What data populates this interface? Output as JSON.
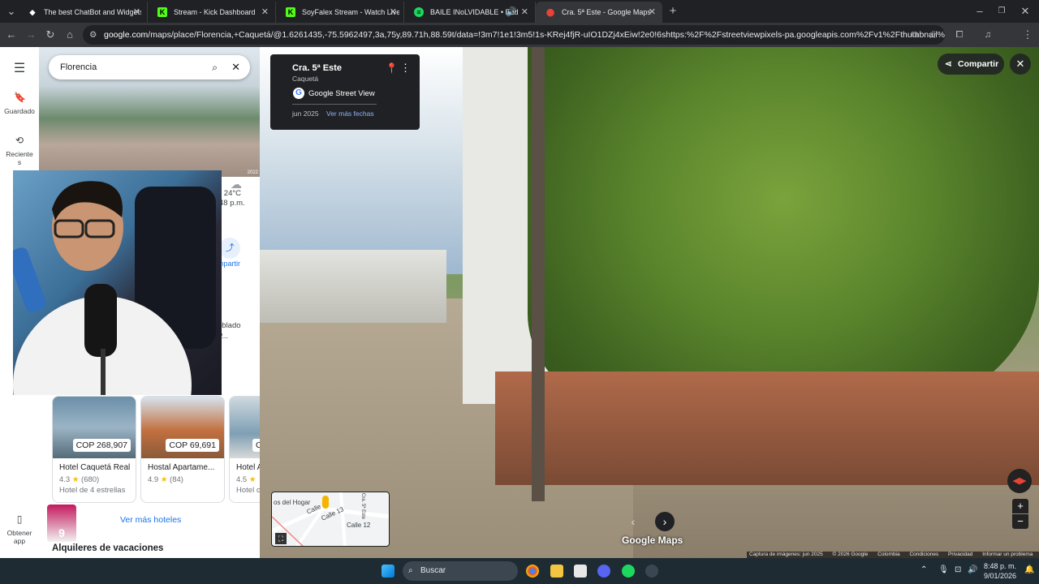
{
  "browser": {
    "tabs": [
      {
        "title": "The best ChatBot and Widgets",
        "icon": "chatbot-icon"
      },
      {
        "title": "Stream - Kick Dashboard",
        "icon": "kick-icon"
      },
      {
        "title": "SoyFalex Stream - Watch Live c",
        "icon": "kick-icon"
      },
      {
        "title": "BAILE INoLVIDABLE • Bad B",
        "icon": "spotify-icon"
      },
      {
        "title": "Cra. 5ª Este - Google Maps",
        "icon": "maps-icon"
      }
    ],
    "url_domain": "google.com",
    "url_rest": "/maps/place/Florencia,+Caquetá/@1.6261435,-75.5962497,3a,75y,89.71h,88.59t/data=!3m7!1e1!3m5!1s-KRej4fjR-uIO1DZj4xEiw!2e0!6shttps:%2F%2Fstreetviewpixels-pa.googleapis.com%2Fv1%2Fthumbnail%3Fcb_client%3Dma..."
  },
  "rail": {
    "saved": "Guardado",
    "recent": "Reciente s",
    "get_app": "Obtener app"
  },
  "panel": {
    "search_value": "Florencia",
    "photo_year": "2022",
    "weather_temp": "· 24°C",
    "weather_time": "48 p.m.",
    "share": "mpartir",
    "frag1": "l",
    "frag2": "oblado",
    "frag3": "P...",
    "hotels": [
      {
        "price": "COP 268,907",
        "name": "Hotel Caquetá Real",
        "rating": "4.3",
        "reviews": "(680)",
        "class": "Hotel de 4 estrellas"
      },
      {
        "price": "COP 69,691",
        "name": "Hostal Apartame...",
        "rating": "4.9",
        "reviews": "(84)",
        "class": ""
      },
      {
        "price": "C",
        "name": "Hotel A",
        "rating": "4.5",
        "reviews": "",
        "class": "Hotel c"
      }
    ],
    "more_hotels": "Ver más hoteles",
    "vacation": "Alquileres de vacaciones"
  },
  "streetview": {
    "street": "Cra. 5ª Este",
    "city": "Caquetá",
    "source": "Google Street View",
    "date": "jun 2025",
    "more_dates": "Ver más fechas",
    "share": "Compartir",
    "brand": "Google Maps",
    "minimap_labels": [
      "os del Hogar",
      "Calle 13",
      "Calle 14",
      "Calle 12",
      "Cra. 5ª Este"
    ],
    "footer": [
      "Captura de imágenes: jun 2025",
      "© 2026 Google",
      "Colombia",
      "Condiciones",
      "Privacidad",
      "Informar un problema"
    ]
  },
  "taskbar": {
    "search": "Buscar",
    "time": "8:48 p. m.",
    "date": "9/01/2026"
  },
  "colors": {
    "accent": "#1a73e8",
    "chrome_bg": "#202124"
  }
}
